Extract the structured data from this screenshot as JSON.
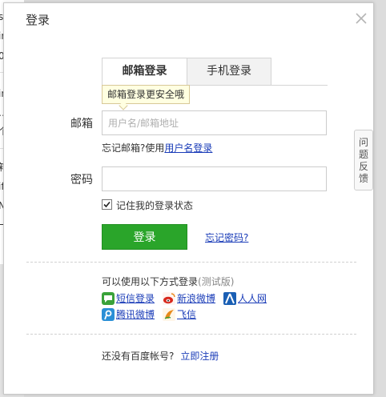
{
  "background": {
    "fragments": [
      "s T",
      "in}",
      "0—",
      "in",
      "…",
      "个",
      "箱",
      "if(",
      "Nu",
      "一个"
    ]
  },
  "dialog": {
    "title": "登录",
    "close_icon": "close-icon"
  },
  "tabs": [
    {
      "label": "邮箱登录",
      "active": true
    },
    {
      "label": "手机登录",
      "active": false
    }
  ],
  "tooltip": "邮箱登录更安全哦",
  "form": {
    "email_label": "邮箱",
    "email_placeholder": "用户名/邮箱地址",
    "email_value": "",
    "forgot_email_text": "忘记邮箱?使用",
    "forgot_email_link": "用户名登录",
    "password_label": "密码",
    "password_value": "",
    "remember_label": "记住我的登录状态",
    "remember_checked": true,
    "login_button": "登录",
    "forgot_password": "忘记密码?"
  },
  "other_login": {
    "title": "可以使用以下方式登录",
    "note": "(测试版)",
    "options": [
      {
        "label": "短信登录",
        "icon": "sms-icon",
        "color": "#3aa23a"
      },
      {
        "label": "新浪微博",
        "icon": "sina-weibo-icon",
        "color": "#d8281c"
      },
      {
        "label": "人人网",
        "icon": "renren-icon",
        "color": "#1a5fb4"
      },
      {
        "label": "腾讯微博",
        "icon": "tencent-weibo-icon",
        "color": "#2a8fd6"
      },
      {
        "label": "飞信",
        "icon": "fetion-icon",
        "color": "#e8891a"
      }
    ]
  },
  "register": {
    "text": "还没有百度帐号?",
    "link": "立即注册"
  },
  "feedback": {
    "chars": [
      "问",
      "题",
      "反",
      "馈"
    ]
  },
  "colors": {
    "primary_button": "#2aa52a",
    "link": "#1a3cb8",
    "tooltip_bg": "#ffffe1"
  }
}
